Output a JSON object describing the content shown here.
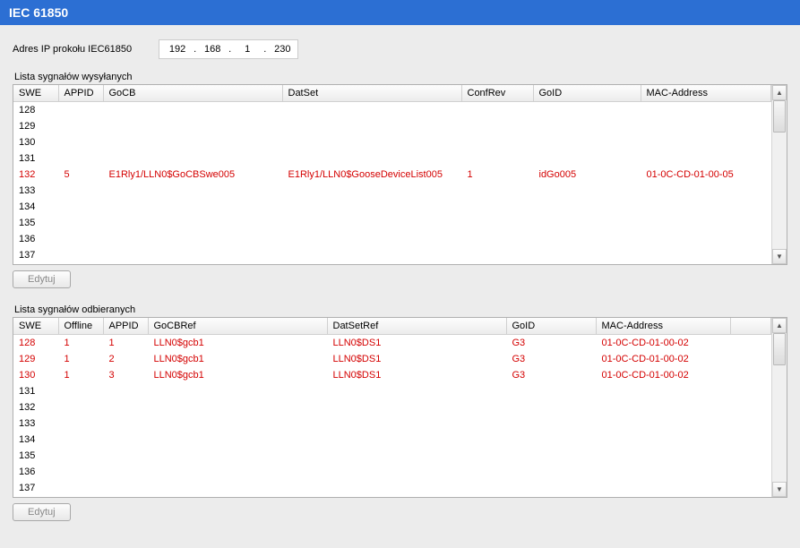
{
  "title": "IEC 61850",
  "ip_label": "Adres IP prokołu IEC61850",
  "ip": {
    "a": "192",
    "b": "168",
    "c": "1",
    "d": "230"
  },
  "sent": {
    "label": "Lista sygnałów wysyłanych",
    "headers": {
      "swe": "SWE",
      "appid": "APPID",
      "gocb": "GoCB",
      "datset": "DatSet",
      "confrev": "ConfRev",
      "goid": "GoID",
      "mac": "MAC-Address"
    },
    "rows": [
      {
        "swe": "128",
        "appid": "",
        "gocb": "",
        "datset": "",
        "confrev": "",
        "goid": "",
        "mac": "",
        "red": false
      },
      {
        "swe": "129",
        "appid": "",
        "gocb": "",
        "datset": "",
        "confrev": "",
        "goid": "",
        "mac": "",
        "red": false
      },
      {
        "swe": "130",
        "appid": "",
        "gocb": "",
        "datset": "",
        "confrev": "",
        "goid": "",
        "mac": "",
        "red": false
      },
      {
        "swe": "131",
        "appid": "",
        "gocb": "",
        "datset": "",
        "confrev": "",
        "goid": "",
        "mac": "",
        "red": false
      },
      {
        "swe": "132",
        "appid": "5",
        "gocb": "E1Rly1/LLN0$GoCBSwe005",
        "datset": "E1Rly1/LLN0$GooseDeviceList005",
        "confrev": "1",
        "goid": "idGo005",
        "mac": "01-0C-CD-01-00-05",
        "red": true
      },
      {
        "swe": "133",
        "appid": "",
        "gocb": "",
        "datset": "",
        "confrev": "",
        "goid": "",
        "mac": "",
        "red": false
      },
      {
        "swe": "134",
        "appid": "",
        "gocb": "",
        "datset": "",
        "confrev": "",
        "goid": "",
        "mac": "",
        "red": false
      },
      {
        "swe": "135",
        "appid": "",
        "gocb": "",
        "datset": "",
        "confrev": "",
        "goid": "",
        "mac": "",
        "red": false
      },
      {
        "swe": "136",
        "appid": "",
        "gocb": "",
        "datset": "",
        "confrev": "",
        "goid": "",
        "mac": "",
        "red": false
      },
      {
        "swe": "137",
        "appid": "",
        "gocb": "",
        "datset": "",
        "confrev": "",
        "goid": "",
        "mac": "",
        "red": false
      }
    ],
    "edit_label": "Edytuj"
  },
  "recv": {
    "label": "Lista sygnałów odbieranych",
    "headers": {
      "swe": "SWE",
      "offline": "Offline",
      "appid": "APPID",
      "gocbref": "GoCBRef",
      "datsetref": "DatSetRef",
      "goid": "GoID",
      "mac": "MAC-Address"
    },
    "rows": [
      {
        "swe": "128",
        "offline": "1",
        "appid": "1",
        "gocbref": "LLN0$gcb1",
        "datsetref": "LLN0$DS1",
        "goid": "G3",
        "mac": "01-0C-CD-01-00-02",
        "red": true
      },
      {
        "swe": "129",
        "offline": "1",
        "appid": "2",
        "gocbref": "LLN0$gcb1",
        "datsetref": "LLN0$DS1",
        "goid": "G3",
        "mac": "01-0C-CD-01-00-02",
        "red": true
      },
      {
        "swe": "130",
        "offline": "1",
        "appid": "3",
        "gocbref": "LLN0$gcb1",
        "datsetref": "LLN0$DS1",
        "goid": "G3",
        "mac": "01-0C-CD-01-00-02",
        "red": true
      },
      {
        "swe": "131",
        "offline": "",
        "appid": "",
        "gocbref": "",
        "datsetref": "",
        "goid": "",
        "mac": "",
        "red": false
      },
      {
        "swe": "132",
        "offline": "",
        "appid": "",
        "gocbref": "",
        "datsetref": "",
        "goid": "",
        "mac": "",
        "red": false
      },
      {
        "swe": "133",
        "offline": "",
        "appid": "",
        "gocbref": "",
        "datsetref": "",
        "goid": "",
        "mac": "",
        "red": false
      },
      {
        "swe": "134",
        "offline": "",
        "appid": "",
        "gocbref": "",
        "datsetref": "",
        "goid": "",
        "mac": "",
        "red": false
      },
      {
        "swe": "135",
        "offline": "",
        "appid": "",
        "gocbref": "",
        "datsetref": "",
        "goid": "",
        "mac": "",
        "red": false
      },
      {
        "swe": "136",
        "offline": "",
        "appid": "",
        "gocbref": "",
        "datsetref": "",
        "goid": "",
        "mac": "",
        "red": false
      },
      {
        "swe": "137",
        "offline": "",
        "appid": "",
        "gocbref": "",
        "datsetref": "",
        "goid": "",
        "mac": "",
        "red": false
      }
    ],
    "edit_label": "Edytuj"
  }
}
